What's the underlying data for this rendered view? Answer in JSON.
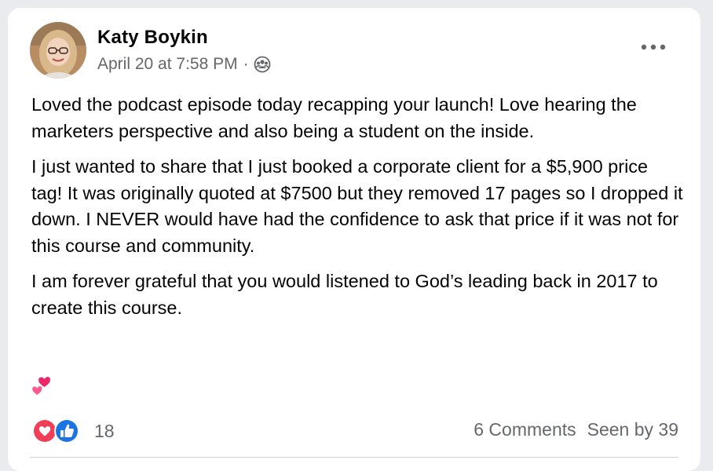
{
  "post": {
    "author": "Katy Boykin",
    "timestamp": "April 20 at 7:58 PM",
    "separator": "·",
    "audience_icon": "group-icon",
    "more_icon": "more-horizontal-icon",
    "paragraphs": [
      "Loved the podcast episode today recapping your launch! Love hearing the marketers perspective and also being a student on the inside.",
      "I just wanted to share that I just booked a corporate client for a $5,900 price tag! It was originally quoted at $7500 but they removed 17 pages so I dropped it down. I NEVER would have had the confidence to ask that price if it was not for this course and community.",
      "I am forever grateful that you would listened to God’s leading back in 2017 to create this course."
    ],
    "emoji": "two-hearts-icon"
  },
  "footer": {
    "reaction_icons": [
      "love-reaction-icon",
      "like-reaction-icon"
    ],
    "reaction_count": "18",
    "comments": "6 Comments",
    "seen_by": "Seen by 39"
  },
  "colors": {
    "love": "#f33e58",
    "like": "#1b74e4",
    "secondary_text": "#65676b",
    "primary_text": "#050505"
  }
}
